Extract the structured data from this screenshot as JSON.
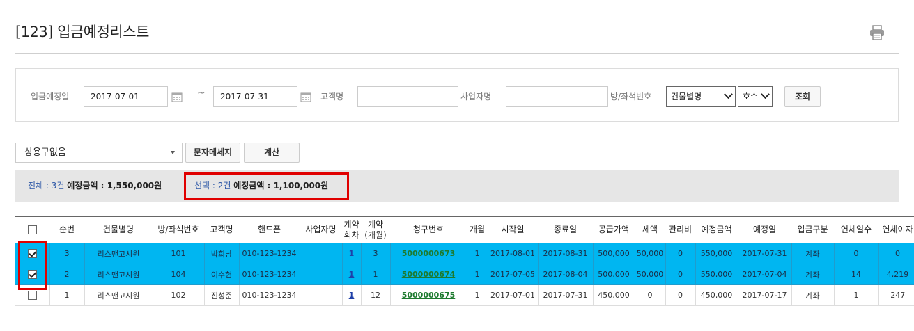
{
  "header": {
    "title": "[123] 입금예정리스트"
  },
  "search": {
    "date_label": "입금예정일",
    "date_from": "2017-07-01",
    "tilde": "~",
    "date_to": "2017-07-31",
    "customer_label": "고객명",
    "customer_value": "",
    "business_label": "사업자명",
    "business_value": "",
    "room_label": "방/좌석번호",
    "building_select": "건물별명",
    "unit_select": "호수",
    "query_button": "조회"
  },
  "toolbar": {
    "phrase_select": "상용구없음",
    "sms_button": "문자메세지",
    "calc_button": "계산"
  },
  "summary": {
    "total_prefix": "전체 : 3건",
    "total_amount": "예정금액 : 1,550,000원",
    "selected_prefix": "선택 : 2건",
    "selected_amount": "예정금액 : 1,100,000원"
  },
  "table": {
    "headers": [
      "",
      "순번",
      "건물별명",
      "방/좌석번호",
      "고객명",
      "핸드폰",
      "사업자명",
      "계약\n회차",
      "계약\n(개월)",
      "청구번호",
      "개월",
      "시작일",
      "종료일",
      "공급가액",
      "세액",
      "관리비",
      "예정금액",
      "예정일",
      "입금구분",
      "연체일수",
      "연체이자"
    ],
    "rows": [
      {
        "selected": true,
        "cells": [
          "3",
          "리스맨고시원",
          "101",
          "박희남",
          "010-123-1234",
          "",
          "1",
          "3",
          "5000000673",
          "1",
          "2017-08-01",
          "2017-08-31",
          "500,000",
          "50,000",
          "0",
          "550,000",
          "2017-07-31",
          "계좌",
          "0",
          "0"
        ]
      },
      {
        "selected": true,
        "cells": [
          "2",
          "리스맨고시원",
          "104",
          "이수현",
          "010-123-1234",
          "",
          "1",
          "1",
          "5000000674",
          "1",
          "2017-07-05",
          "2017-08-04",
          "500,000",
          "50,000",
          "0",
          "550,000",
          "2017-07-04",
          "계좌",
          "14",
          "4,219"
        ]
      },
      {
        "selected": false,
        "cells": [
          "1",
          "리스맨고시원",
          "102",
          "진성준",
          "010-123-1234",
          "",
          "1",
          "12",
          "5000000675",
          "1",
          "2017-07-01",
          "2017-07-31",
          "450,000",
          "0",
          "0",
          "450,000",
          "2017-07-17",
          "계좌",
          "1",
          "247"
        ]
      }
    ]
  },
  "colors": {
    "selected_row": "#00b6f1",
    "highlight": "#e00000",
    "link": "#1f40a8",
    "bill_link": "#1d7a2e"
  },
  "icons": {
    "print": "printer-icon",
    "calendar": "calendar-icon"
  }
}
